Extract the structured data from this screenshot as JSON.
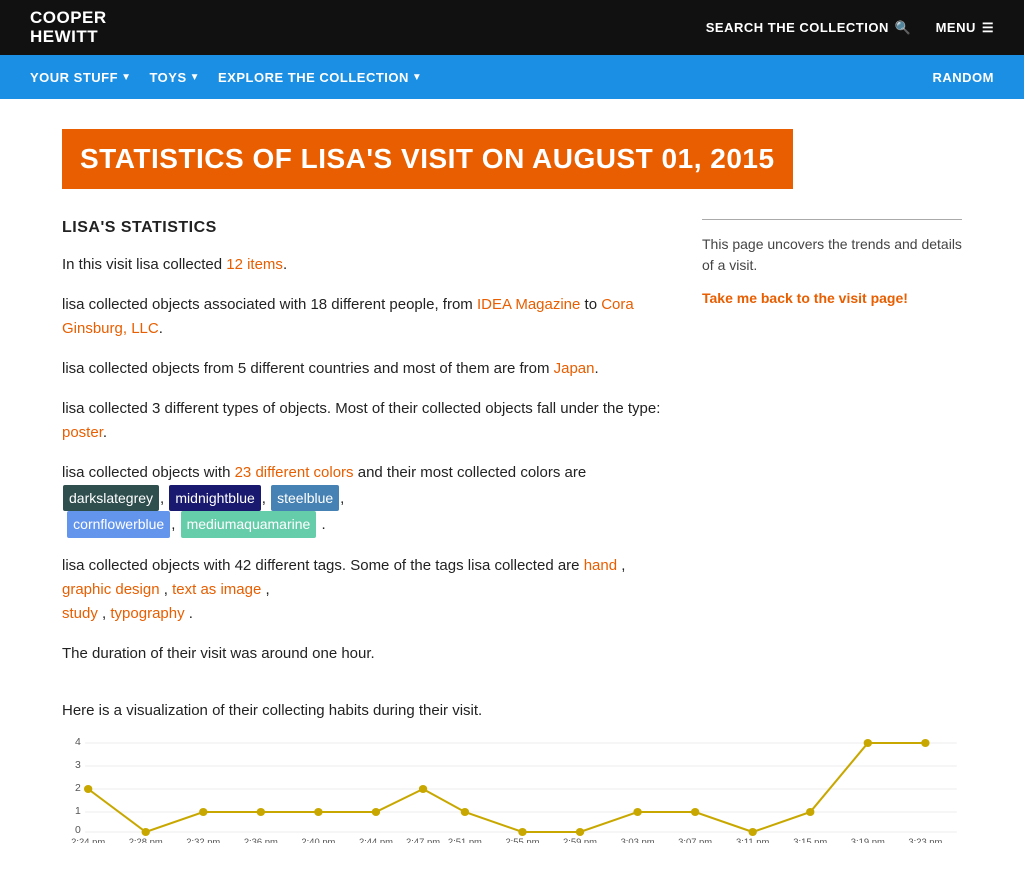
{
  "header": {
    "logo_line1": "COOPER",
    "logo_line2": "HEWITT",
    "search_label": "SEARCH THE COLLECTION",
    "menu_label": "MENU"
  },
  "nav": {
    "items": [
      {
        "label": "YOUR STUFF",
        "has_arrow": true
      },
      {
        "label": "TOYS",
        "has_arrow": true
      },
      {
        "label": "EXPLORE THE COLLECTION",
        "has_arrow": true
      }
    ],
    "right_item": "RANDOM"
  },
  "page": {
    "title": "STATISTICS OF LISA'S VISIT ON AUGUST 01, 2015",
    "sidebar_desc": "This page uncovers the trends and details of a visit.",
    "sidebar_link": "Take me back to the visit page!",
    "section_title": "LISA'S STATISTICS",
    "stat1": "In this visit lisa collected ",
    "stat1_count": "12 items",
    "stat1_end": ".",
    "stat2_pre": "lisa collected objects associated with 18 different people, from ",
    "stat2_link1": "IDEA Magazine",
    "stat2_mid": " to ",
    "stat2_link2": "Cora Ginsburg, LLC",
    "stat2_end": ".",
    "stat3_pre": "lisa collected objects from 5 different countries and most of them are from ",
    "stat3_link": "Japan",
    "stat3_end": ".",
    "stat4_pre": "lisa collected 3 different types of objects. Most of their collected objects fall under the type: ",
    "stat4_link": "poster",
    "stat4_end": ".",
    "stat5_pre": "lisa collected objects with ",
    "stat5_link": "23 different colors",
    "stat5_mid": " and their most collected colors are ",
    "colors": [
      {
        "label": "darkslategrey",
        "class": "badge-darkslategrey"
      },
      {
        "label": "midnightblue",
        "class": "badge-midnightblue"
      },
      {
        "label": "steelblue",
        "class": "badge-steelblue"
      },
      {
        "label": "cornflowerblue",
        "class": "badge-cornflowerblue"
      },
      {
        "label": "mediumaquamarine",
        "class": "badge-mediumaquamarine"
      }
    ],
    "stat6_pre": "lisa collected objects with 42 different tags. Some of the tags lisa collected are ",
    "tag1": "hand",
    "tag2": "graphic design",
    "tag3": "text as image",
    "tag4": "study",
    "tag5": "typography",
    "stat6_end": ".",
    "stat7": "The duration of their visit was around one hour.",
    "chart_label": "Here is a visualization of their collecting habits during their visit.",
    "chart_y_labels": [
      "0",
      "1",
      "2",
      "3",
      "4"
    ],
    "chart_x_labels": [
      "2:24 pm",
      "2:28 pm",
      "2:32 pm",
      "2:36 pm",
      "2:40 pm",
      "2:44 pm",
      "2:47 pm",
      "2:51 pm",
      "2:55 pm",
      "2:59 pm",
      "3:03 pm",
      "3:07 pm",
      "3:11 pm",
      "3:15 pm",
      "3:19 pm",
      "3:23 pm"
    ]
  }
}
